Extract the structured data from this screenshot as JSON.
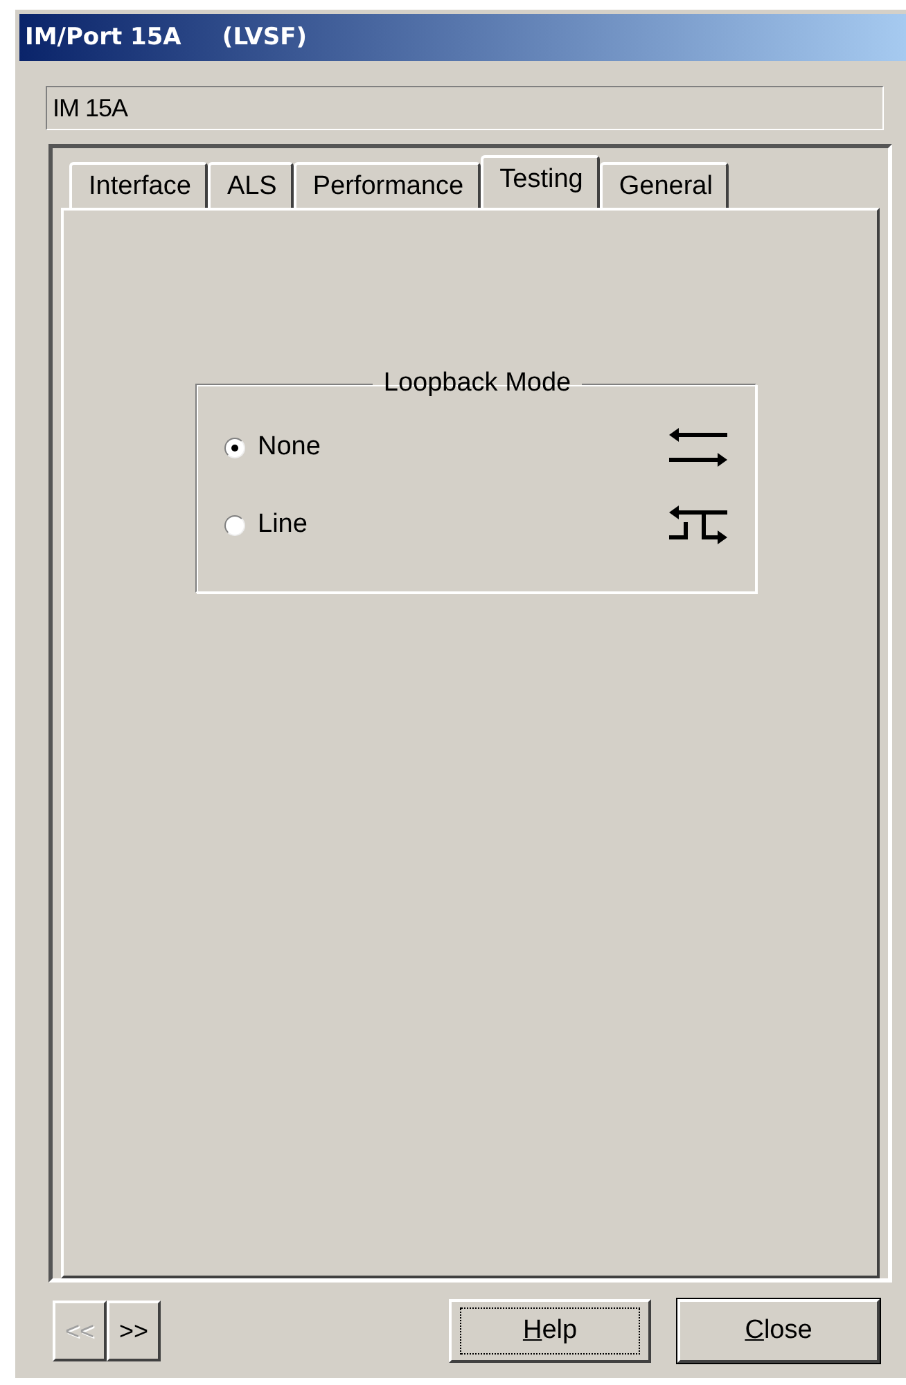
{
  "window": {
    "title": "IM/Port 15A     (LVSF)"
  },
  "name_field": {
    "value": "IM 15A"
  },
  "tabs": [
    {
      "label": "Interface",
      "selected": false
    },
    {
      "label": "ALS",
      "selected": false
    },
    {
      "label": "Performance",
      "selected": false
    },
    {
      "label": "Testing",
      "selected": true
    },
    {
      "label": "General",
      "selected": false
    }
  ],
  "loopback_group": {
    "title": "Loopback Mode",
    "options": [
      {
        "label": "None",
        "kind": "straight",
        "selected": true
      },
      {
        "label": "Line",
        "kind": "looped",
        "selected": false
      }
    ]
  },
  "nav_buttons": [
    {
      "label": "<<",
      "disabled": true
    },
    {
      "label": ">>",
      "disabled": false
    }
  ],
  "buttons": [
    {
      "label": "Help",
      "focused": true,
      "default": false
    },
    {
      "label": "Close",
      "focused": false,
      "default": true
    }
  ]
}
